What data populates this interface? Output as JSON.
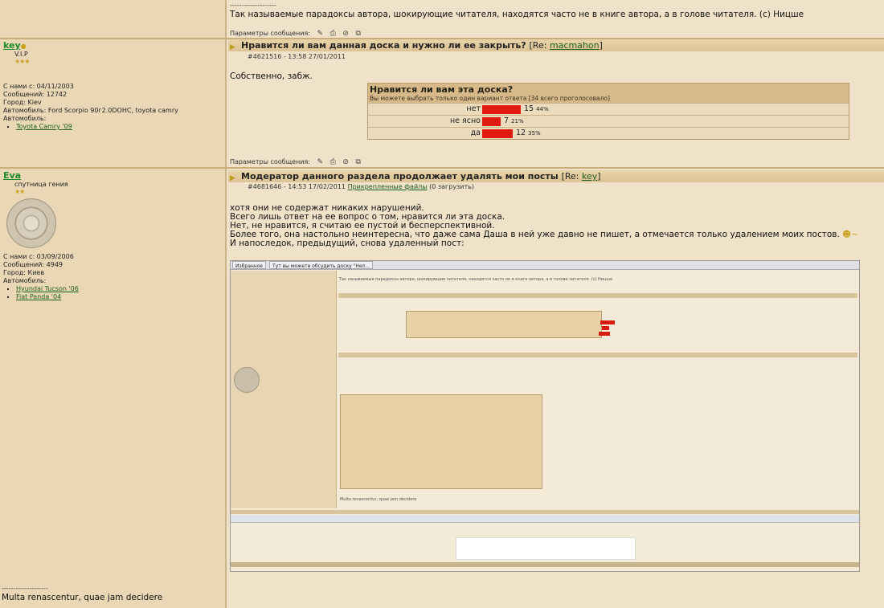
{
  "top": {
    "separator": "--------------------",
    "signature": "Так называемые парадоксы автора, шокирующие читателя, находятся часто не в книге автора, а в голове читателя. (с) Ницше",
    "params_label": "Параметры сообщения:"
  },
  "user1": {
    "name": "key",
    "rank": "V.I.P",
    "stars": "★★★",
    "joined": "С нами с: 04/11/2003",
    "posts": "Сообщений: 12742",
    "city": "Город: Kiev",
    "car": "Автомобиль: Ford Scorpio 90г2.0DOHC, toyota camry",
    "cars_label": "Автомобиль:",
    "cars": [
      "Toyota Camry '09"
    ]
  },
  "post1": {
    "title": "Нравится ли вам данная доска и нужно ли ее закрыть?",
    "re_prefix": "[Re:",
    "re_user": "macmahon",
    "re_suffix": "]",
    "meta": "#4621516 - 13:58 27/01/2011",
    "body": "Собственно, забж.",
    "params_label": "Параметры сообщения:"
  },
  "poll": {
    "question": "Нравится ли вам эта доска?",
    "subtitle": "Вы можете выбрать только один вариант ответа [34 всего проголосовало]",
    "options": [
      {
        "label": "нет",
        "count": "15",
        "pct": "44%",
        "share": 0.44
      },
      {
        "label": "не ясно",
        "count": "7",
        "pct": "21%",
        "share": 0.21
      },
      {
        "label": "да",
        "count": "12",
        "pct": "35%",
        "share": 0.35
      }
    ]
  },
  "user2": {
    "name": "Eva",
    "rank": "спутница гения",
    "stars": "★★",
    "joined": "С нами с: 03/09/2006",
    "posts": "Сообщений: 4949",
    "city": "Город: Киев",
    "cars_label": "Автомобиль:",
    "cars": [
      "Hyundai Tucson '06",
      "Fiat Panda '04"
    ]
  },
  "post2": {
    "title": "Модератор данного раздела продолжает удалять мои посты",
    "re_prefix": "[Re:",
    "re_user": "key",
    "re_suffix": "]",
    "meta": "#4681646 - 14:53 17/02/2011",
    "attach_link": "Прикрепленные файлы",
    "attach_count": "(0 загрузить)",
    "lines": [
      "хотя они не содержат никаких нарушений.",
      "Всего лишь ответ на ее вопрос о том, нравится ли эта доска.",
      "Нет, не нравится, я считаю ее пустой и бесперспективной.",
      "Более того, она настольно неинтересна, что даже сама Даша в ней уже давно не пишет, а отмечается только удалением моих постов.",
      "И напоследок, предыдущий, снова удаленный пост:"
    ],
    "separator": "--------------------",
    "signature": "Multa renascentur, quae jam decidere"
  },
  "screenshot": {
    "tab1": "Избранное",
    "tab2": "Тут вы можете обсудить доску \"Нел...",
    "quote": "Так называемые парадоксы автора, шокирующие читателя, находятся часто не в книге автора, а в голове читателя. (с) Ницше",
    "sig": "Multa renascentur, quae jam decidere"
  },
  "colors": {
    "background": "#efe2c9",
    "left_column": "#e9d7b6",
    "title_bar": "#ddc394",
    "poll_bar": "#e01a10",
    "username": "#1d8a2a"
  }
}
